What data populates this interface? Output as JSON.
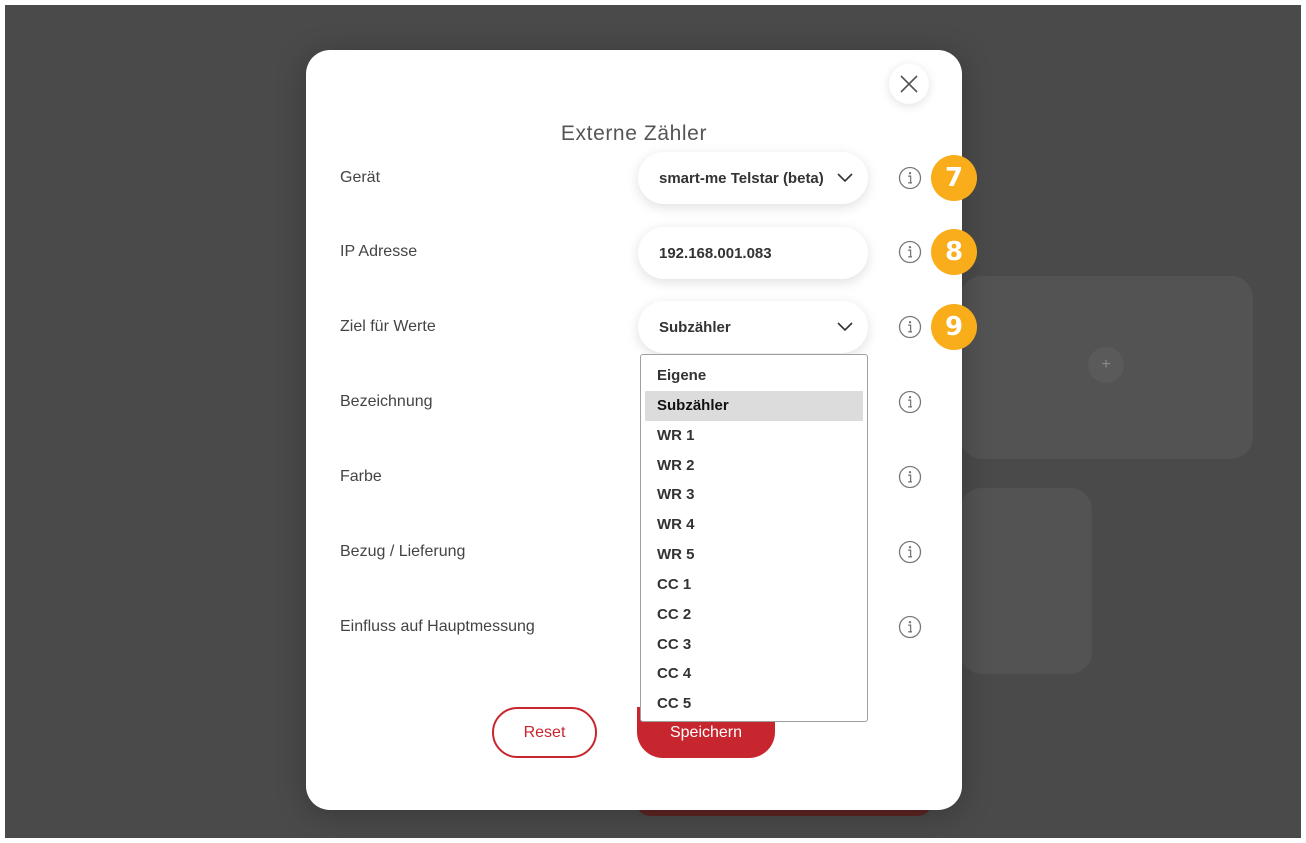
{
  "modal": {
    "title": "Externe Zähler",
    "rows": [
      {
        "label": "Gerät",
        "value": "smart-me Telstar (beta)",
        "badge": "7"
      },
      {
        "label": "IP Adresse",
        "value": "192.168.001.083",
        "badge": "8"
      },
      {
        "label": "Ziel für Werte",
        "value": "Subzähler",
        "badge": "9"
      },
      {
        "label": "Bezeichnung"
      },
      {
        "label": "Farbe"
      },
      {
        "label": "Bezug / Lieferung"
      },
      {
        "label": "Einfluss auf Hauptmessung"
      }
    ],
    "dropdown": {
      "options": [
        "Eigene",
        "Subzähler",
        "WR 1",
        "WR 2",
        "WR 3",
        "WR 4",
        "WR 5",
        "CC 1",
        "CC 2",
        "CC 3",
        "CC 4",
        "CC 5"
      ],
      "selected": "Subzähler"
    },
    "buttons": {
      "reset": "Reset",
      "save": "Speichern"
    }
  },
  "background": {
    "plus_symbol": "+"
  },
  "colors": {
    "accent_red": "#c8262e",
    "badge_orange": "#f9ad1a",
    "backdrop": "#4a4a4a"
  },
  "icons": [
    "close-icon",
    "info-icon",
    "chevron-down-icon",
    "plus-icon"
  ]
}
